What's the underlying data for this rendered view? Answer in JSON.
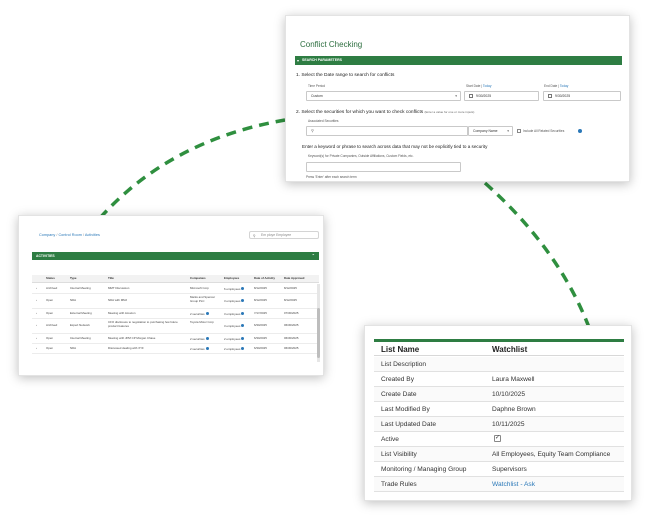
{
  "conflict_checking": {
    "title": "Conflict Checking",
    "section": "SEARCH PARAMETERS",
    "step1": "1. Select the Date range to search for conflicts",
    "time_period_label": "Time Period",
    "time_period_value": "Custom",
    "start_date_label": "Start Date",
    "end_date_label": "End Date",
    "today_link": "Today",
    "start_date_value": "9/30/2025",
    "end_date_value": "9/30/2025",
    "step2": "2. Select the securities for which you want to check conflicts",
    "step2_hint": "(Enter a value for one or more inputs)",
    "associated_securities_label": "Associated Securities",
    "company_name_select": "Company Name",
    "include_related_label": "Include All Related Securities",
    "step3": "Enter a keyword or phrase to search across data that may not be explicitly tied to a security",
    "keyword_label": "Keyword(s) for Private Companies, Outside Affiliations, Custom Fields, etc.",
    "keyword_hint": "Press 'Enter' after each search term"
  },
  "activities": {
    "breadcrumb": [
      "Company",
      "Control Room",
      "Activities"
    ],
    "employee_search_placeholder": "Em ploye Employee",
    "bar_title": "ACTIVITIES",
    "columns": [
      "Status",
      "Type",
      "Title",
      "Companies",
      "Employees",
      "Date of Activity",
      "Date Approved"
    ],
    "rows": [
      {
        "status": "Archived",
        "type": "Internal Meeting",
        "title": "MMT Discussion",
        "companies": "Microsoft Corp",
        "employees": "6 employees",
        "date": "8/12/2025",
        "approved": "8/12/2025"
      },
      {
        "status": "Open",
        "type": "NDA",
        "title": "NDA with MMJ",
        "companies": "Marks and Spencer Group PLC",
        "employees": "3 employees",
        "date": "8/12/2025",
        "approved": "8/12/2025"
      },
      {
        "status": "Open",
        "type": "External Meeting",
        "title": "Meeting with Amazon",
        "companies": "2 securities",
        "employees": "3 employees",
        "date": "7/17/2025",
        "approved": "07/30/2025"
      },
      {
        "status": "Archived",
        "type": "Expert Network",
        "title": "CFO disclosure to negotiation to purchasing few future product features",
        "companies": "Toyota Motor Corp",
        "employees": "3 employees",
        "date": "6/30/2025",
        "approved": "06/30/2025"
      },
      {
        "status": "Open",
        "type": "Internal Meeting",
        "title": "Meeting with JPM CP Morgan Chase",
        "companies": "2 securities",
        "employees": "2 employees",
        "date": "6/30/2025",
        "approved": "06/30/2025"
      },
      {
        "status": "Open",
        "type": "NDA",
        "title": "Discussed dealing with XYF",
        "companies": "2 securities",
        "employees": "2 employees",
        "date": "6/30/2025",
        "approved": "06/30/2025"
      }
    ]
  },
  "watchlist": {
    "header_key": "List Name",
    "header_value": "Watchlist",
    "rows": [
      {
        "key": "List Description",
        "value": ""
      },
      {
        "key": "Created By",
        "value": "Laura Maxwell"
      },
      {
        "key": "Create Date",
        "value": "10/10/2025"
      },
      {
        "key": "Last Modified By",
        "value": "Daphne Brown"
      },
      {
        "key": "Last Updated Date",
        "value": "10/11/2025"
      },
      {
        "key": "Active",
        "value": "✓"
      },
      {
        "key": "List Visibility",
        "value": "All Employees, Equity Team Compliance"
      },
      {
        "key": "Monitoring / Managing Group",
        "value": "Supervisors"
      },
      {
        "key": "Trade Rules",
        "value": "Watchlist - Ask"
      }
    ]
  },
  "colors": {
    "brand_green": "#2e7d43",
    "connector_green": "#2f8f3f",
    "link_blue": "#2a78b8"
  }
}
